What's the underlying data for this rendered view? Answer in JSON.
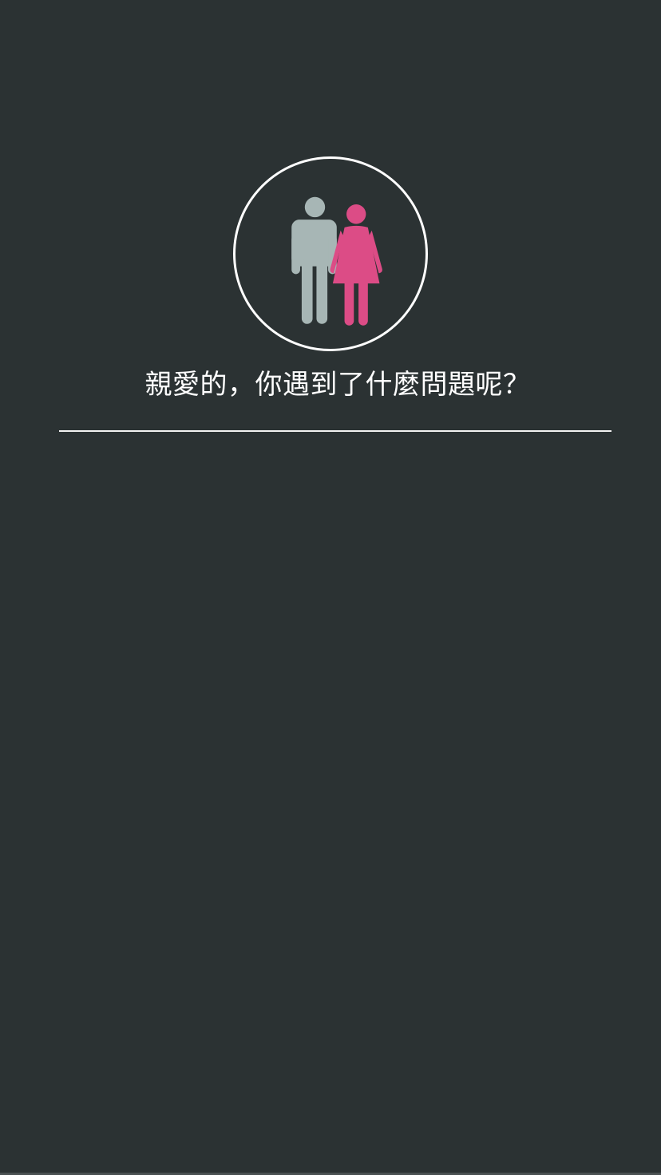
{
  "prompt": {
    "question": "親愛的，你遇到了什麼問題呢？"
  },
  "avatar": {
    "icon": "couple-icon",
    "colors": {
      "male": "#a7b6b5",
      "female": "#dc4c86",
      "ring": "#ffffff"
    }
  },
  "theme": {
    "background": "#2b3233",
    "text": "#ffffff",
    "divider": "#f2f2f2"
  }
}
